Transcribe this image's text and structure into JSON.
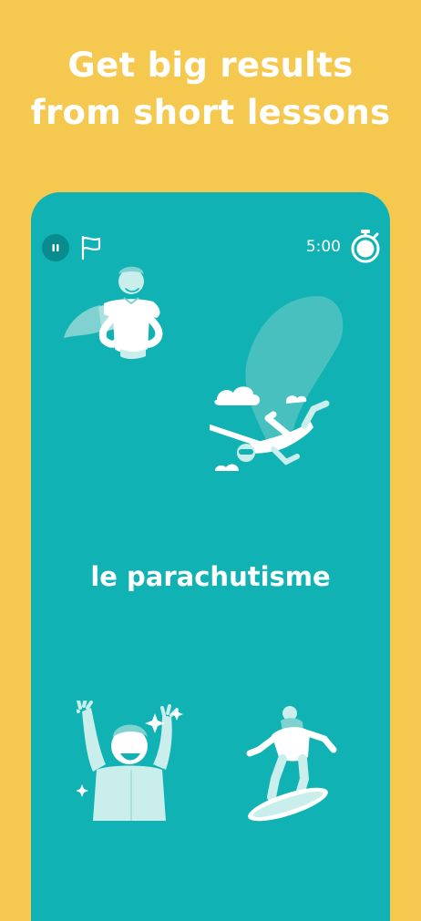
{
  "headline": {
    "line1": "Get big results",
    "line2": "from short lessons"
  },
  "toolbar": {
    "pause_icon": "pause-icon",
    "flag_icon": "flag-icon",
    "timer": "5:00",
    "stopwatch_icon": "stopwatch-icon"
  },
  "prompt": {
    "word": "le parachutisme"
  },
  "options": [
    {
      "illustration": "superhero"
    },
    {
      "illustration": "skydiver"
    },
    {
      "illustration": "cheering-person"
    },
    {
      "illustration": "snowboarder"
    }
  ],
  "colors": {
    "background": "#F5C94F",
    "card": "#10B2B3",
    "accent_dark": "#0A8B8D",
    "illustration_light": "#C9EEEC"
  }
}
